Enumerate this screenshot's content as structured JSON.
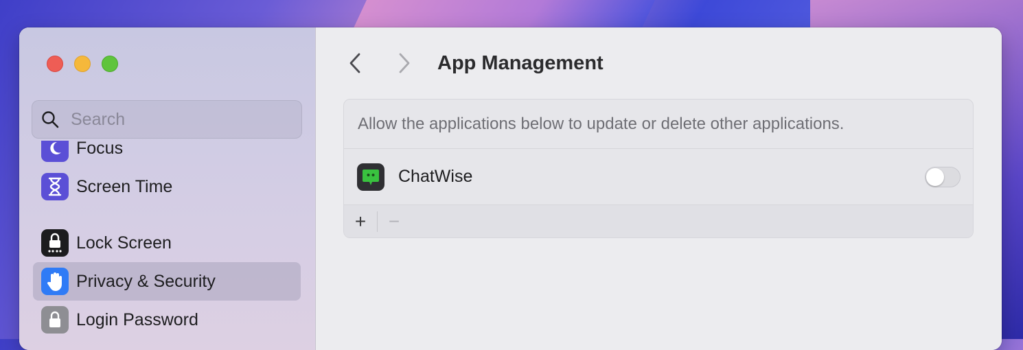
{
  "window": {
    "title": "App Management"
  },
  "sidebar": {
    "search_placeholder": "Search",
    "items": [
      {
        "label": "Focus",
        "icon": "moon-icon",
        "color": "#5b4fd6"
      },
      {
        "label": "Screen Time",
        "icon": "hourglass-icon",
        "color": "#5b4fd6"
      },
      {
        "label": "Lock Screen",
        "icon": "lock-screen-icon",
        "color": "#1c1c1e"
      },
      {
        "label": "Privacy & Security",
        "icon": "hand-icon",
        "color": "#2f7bf6",
        "selected": true
      },
      {
        "label": "Login Password",
        "icon": "padlock-icon",
        "color": "#8e8e93"
      }
    ]
  },
  "main": {
    "description": "Allow the applications below to update or delete other applications.",
    "apps": [
      {
        "name": "ChatWise",
        "icon": "chatwise-icon",
        "enabled": false
      }
    ],
    "footer": {
      "add_label": "+",
      "remove_label": "−"
    }
  }
}
